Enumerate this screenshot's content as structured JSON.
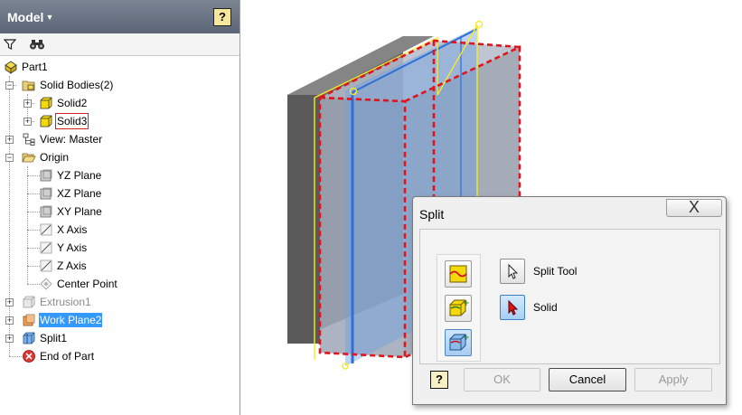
{
  "panel": {
    "title": "Model",
    "help_label": "?",
    "toolbar": {
      "filter_icon": "filter-icon",
      "find_icon": "binoculars-icon"
    }
  },
  "tree": {
    "part": "Part1",
    "solid_bodies": "Solid Bodies(2)",
    "solid2": "Solid2",
    "solid3": "Solid3",
    "view": "View: Master",
    "origin": "Origin",
    "yz_plane": "YZ Plane",
    "xz_plane": "XZ Plane",
    "xy_plane": "XY Plane",
    "x_axis": "X Axis",
    "y_axis": "Y Axis",
    "z_axis": "Z Axis",
    "center_point": "Center Point",
    "extrusion1": "Extrusion1",
    "work_plane2": "Work Plane2",
    "split1": "Split1",
    "end_of_part": "End of Part"
  },
  "dialog": {
    "title": "Split",
    "close_label": "X",
    "split_tool": "Split Tool",
    "solid": "Solid",
    "help_label": "?",
    "ok": "OK",
    "cancel": "Cancel",
    "apply": "Apply"
  },
  "colors": {
    "selection": "#3399ff",
    "body_gray": "#6d6d6d",
    "preview_red": "#e0141c",
    "plane_blue": "#6f9fe0"
  }
}
